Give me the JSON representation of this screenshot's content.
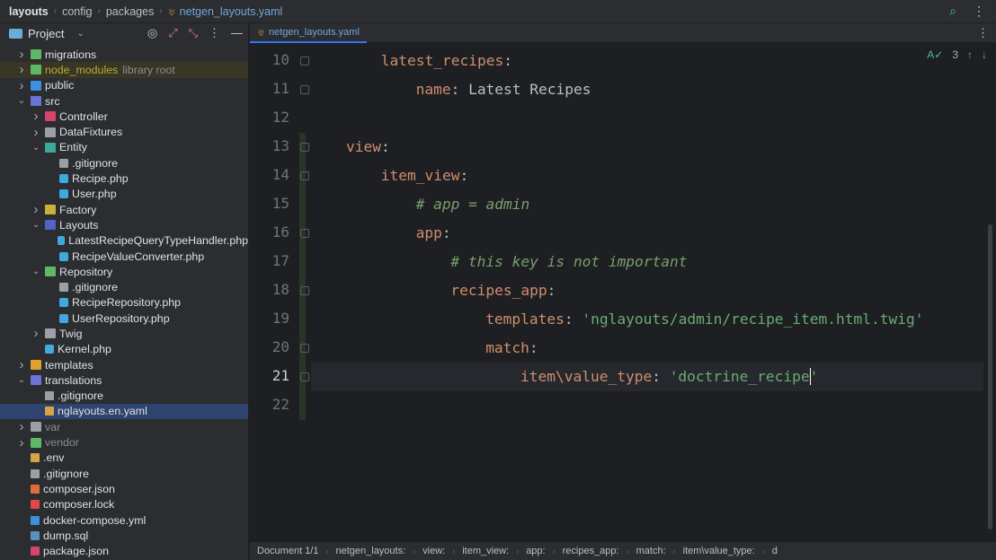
{
  "breadcrumb": {
    "items": [
      "layouts",
      "config",
      "packages"
    ],
    "file": "netgen_layouts.yaml"
  },
  "sidebar": {
    "title": "Project",
    "tree": [
      {
        "label": "migrations",
        "depth": 0,
        "chev": ">",
        "icon": "folder-icon",
        "color": "#5fb865"
      },
      {
        "label": "node_modules",
        "extra": "library root",
        "depth": 0,
        "chev": ">",
        "icon": "folder-icon",
        "color": "#5fb865",
        "highlight": true
      },
      {
        "label": "public",
        "depth": 0,
        "chev": ">",
        "icon": "folder-icon",
        "color": "#3d8fe0"
      },
      {
        "label": "src",
        "depth": 0,
        "chev": "v",
        "icon": "folder-icon",
        "color": "#6a73d6"
      },
      {
        "label": "Controller",
        "depth": 1,
        "chev": ">",
        "icon": "folder-icon",
        "color": "#d6456b"
      },
      {
        "label": "DataFixtures",
        "depth": 1,
        "chev": ">",
        "icon": "folder-icon",
        "color": "#9aa0a6"
      },
      {
        "label": "Entity",
        "depth": 1,
        "chev": "v",
        "icon": "folder-icon",
        "color": "#3aa89b"
      },
      {
        "label": ".gitignore",
        "depth": 2,
        "chev": "",
        "icon": "gitignore-icon",
        "color": "#9aa0a6"
      },
      {
        "label": "Recipe.php",
        "depth": 2,
        "chev": "",
        "icon": "php-class-icon",
        "color": "#3fa9e0"
      },
      {
        "label": "User.php",
        "depth": 2,
        "chev": "",
        "icon": "php-class-icon",
        "color": "#3fa9e0"
      },
      {
        "label": "Factory",
        "depth": 1,
        "chev": ">",
        "icon": "folder-icon",
        "color": "#c6b23a"
      },
      {
        "label": "Layouts",
        "depth": 1,
        "chev": "v",
        "icon": "folder-icon",
        "color": "#4f63c9"
      },
      {
        "label": "LatestRecipeQueryTypeHandler.php",
        "depth": 2,
        "chev": "",
        "icon": "php-class-icon",
        "color": "#3fa9e0"
      },
      {
        "label": "RecipeValueConverter.php",
        "depth": 2,
        "chev": "",
        "icon": "php-class-icon",
        "color": "#3fa9e0"
      },
      {
        "label": "Repository",
        "depth": 1,
        "chev": "v",
        "icon": "folder-icon",
        "color": "#5fb865"
      },
      {
        "label": ".gitignore",
        "depth": 2,
        "chev": "",
        "icon": "gitignore-icon",
        "color": "#9aa0a6"
      },
      {
        "label": "RecipeRepository.php",
        "depth": 2,
        "chev": "",
        "icon": "php-class-icon",
        "color": "#3fa9e0"
      },
      {
        "label": "UserRepository.php",
        "depth": 2,
        "chev": "",
        "icon": "php-class-icon",
        "color": "#3fa9e0"
      },
      {
        "label": "Twig",
        "depth": 1,
        "chev": ">",
        "icon": "folder-icon",
        "color": "#9aa0a6"
      },
      {
        "label": "Kernel.php",
        "depth": 1,
        "chev": "",
        "icon": "php-class-icon",
        "color": "#3fa9e0"
      },
      {
        "label": "templates",
        "depth": 0,
        "chev": ">",
        "icon": "folder-icon",
        "color": "#e0a030"
      },
      {
        "label": "translations",
        "depth": 0,
        "chev": "v",
        "icon": "folder-icon",
        "color": "#6a73d6"
      },
      {
        "label": ".gitignore",
        "depth": 1,
        "chev": "",
        "icon": "gitignore-icon",
        "color": "#9aa0a6"
      },
      {
        "label": "nglayouts.en.yaml",
        "depth": 1,
        "chev": "",
        "icon": "yaml-icon",
        "color": "#d9a343",
        "selected": true
      },
      {
        "label": "var",
        "depth": 0,
        "chev": ">",
        "icon": "folder-icon",
        "color": "#9aa0a6",
        "dim": true
      },
      {
        "label": "vendor",
        "depth": 0,
        "chev": ">",
        "icon": "folder-icon",
        "color": "#5fb865",
        "dim": true
      },
      {
        "label": ".env",
        "depth": 0,
        "chev": "",
        "icon": "env-icon",
        "color": "#d9a343"
      },
      {
        "label": ".gitignore",
        "depth": 0,
        "chev": "",
        "icon": "gitignore-icon",
        "color": "#9aa0a6"
      },
      {
        "label": "composer.json",
        "depth": 0,
        "chev": "",
        "icon": "composer-icon",
        "color": "#e06c3c"
      },
      {
        "label": "composer.lock",
        "depth": 0,
        "chev": "",
        "icon": "lock-icon",
        "color": "#e04848"
      },
      {
        "label": "docker-compose.yml",
        "depth": 0,
        "chev": "",
        "icon": "docker-icon",
        "color": "#3d8fe0"
      },
      {
        "label": "dump.sql",
        "depth": 0,
        "chev": "",
        "icon": "sql-icon",
        "color": "#5a8fc0"
      },
      {
        "label": "package.json",
        "depth": 0,
        "chev": "",
        "icon": "npm-icon",
        "color": "#d6456b"
      }
    ]
  },
  "editor": {
    "tab": "netgen_layouts.yaml",
    "inspection_count": "3",
    "current_line": 21,
    "lines": [
      {
        "n": "10",
        "indent": 1,
        "parts": [
          {
            "t": "latest_recipes",
            "c": "k"
          },
          {
            "t": ":",
            "c": "v"
          }
        ]
      },
      {
        "n": "11",
        "indent": 2,
        "parts": [
          {
            "t": "name",
            "c": "k"
          },
          {
            "t": ": Latest Recipes",
            "c": "v"
          }
        ]
      },
      {
        "n": "12",
        "indent": 0,
        "parts": []
      },
      {
        "n": "13",
        "indent": 0,
        "parts": [
          {
            "t": "view",
            "c": "k"
          },
          {
            "t": ":",
            "c": "v"
          }
        ]
      },
      {
        "n": "14",
        "indent": 1,
        "parts": [
          {
            "t": "item_view",
            "c": "k"
          },
          {
            "t": ":",
            "c": "v"
          }
        ]
      },
      {
        "n": "15",
        "indent": 2,
        "parts": [
          {
            "t": "# app = admin",
            "c": "c"
          }
        ]
      },
      {
        "n": "16",
        "indent": 2,
        "parts": [
          {
            "t": "app",
            "c": "k"
          },
          {
            "t": ":",
            "c": "v"
          }
        ]
      },
      {
        "n": "17",
        "indent": 3,
        "parts": [
          {
            "t": "# this key is not important",
            "c": "c"
          }
        ]
      },
      {
        "n": "18",
        "indent": 3,
        "parts": [
          {
            "t": "recipes_app",
            "c": "k"
          },
          {
            "t": ":",
            "c": "v"
          }
        ]
      },
      {
        "n": "19",
        "indent": 4,
        "parts": [
          {
            "t": "templates",
            "c": "k"
          },
          {
            "t": ": ",
            "c": "v"
          },
          {
            "t": "'nglayouts/admin/recipe_item.html.twig'",
            "c": "s"
          }
        ]
      },
      {
        "n": "20",
        "indent": 4,
        "parts": [
          {
            "t": "match",
            "c": "k"
          },
          {
            "t": ":",
            "c": "v"
          }
        ]
      },
      {
        "n": "21",
        "indent": 5,
        "parts": [
          {
            "t": "item\\value_type",
            "c": "k"
          },
          {
            "t": ": ",
            "c": "v"
          },
          {
            "t": "'doctrine_recipe'",
            "c": "s"
          }
        ]
      },
      {
        "n": "22",
        "indent": 0,
        "parts": []
      }
    ]
  },
  "statusbar": {
    "items": [
      "Document 1/1",
      "netgen_layouts:",
      "view:",
      "item_view:",
      "app:",
      "recipes_app:",
      "match:",
      "item\\value_type:",
      "d"
    ]
  }
}
